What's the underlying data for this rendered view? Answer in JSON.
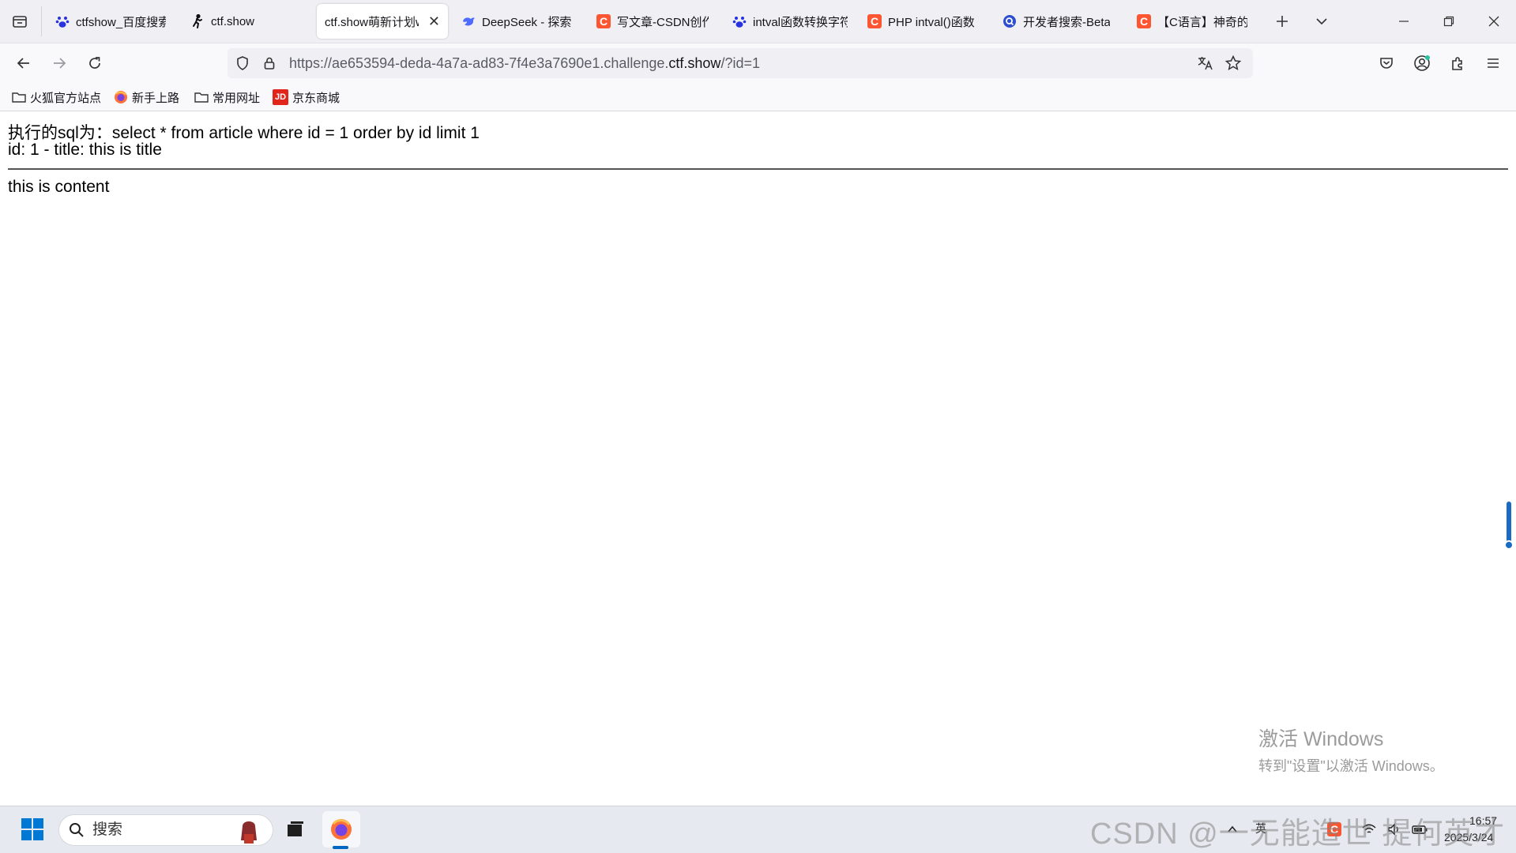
{
  "browser": {
    "tabs": [
      {
        "title": "ctfshow_百度搜索",
        "icon": "baidu-paw-icon",
        "active": false
      },
      {
        "title": "ctf.show",
        "icon": "ctfshow-runner-icon",
        "active": false
      },
      {
        "title": "ctf.show萌新计划web",
        "icon": "none",
        "active": true
      },
      {
        "title": "DeepSeek - 探索",
        "icon": "deepseek-whale-icon",
        "active": false
      },
      {
        "title": "写文章-CSDN创作",
        "icon": "csdn-icon",
        "active": false
      },
      {
        "title": "intval函数转换字符",
        "icon": "baidu-paw-icon",
        "active": false
      },
      {
        "title": "PHP intval()函数",
        "icon": "csdn-icon",
        "active": false
      },
      {
        "title": "开发者搜索-Beta",
        "icon": "dev-search-icon",
        "active": false
      },
      {
        "title": "【C语言】神奇的",
        "icon": "csdn-icon",
        "active": false
      }
    ],
    "url": {
      "prefix": "https://ae653594-deda-4a7a-ad83-7f4e3a7690e1.challenge.",
      "host": "ctf.show",
      "suffix": "/?id=1"
    },
    "bookmarks": [
      {
        "label": "火狐官方站点",
        "icon": "folder-icon"
      },
      {
        "label": "新手上路",
        "icon": "firefox-icon"
      },
      {
        "label": "常用网址",
        "icon": "folder-icon"
      },
      {
        "label": "京东商城",
        "icon": "jd-icon",
        "badge": "JD"
      }
    ],
    "csdn_glyph": "C"
  },
  "page": {
    "sql_line": "执行的sql为：select * from article where id = 1 order by id limit 1",
    "row_line": "id: 1 - title: this is title",
    "content_line": "this is content"
  },
  "overlay": {
    "activate_title": "激活 Windows",
    "activate_sub": "转到\"设置\"以激活 Windows。"
  },
  "taskbar": {
    "search_label": "搜索",
    "tray_ime": "英",
    "time": "16:57",
    "date": "2025/3/24",
    "watermark": "CSDN @一无能造世 提何英才"
  },
  "colors": {
    "accent": "#0067c0",
    "csdn": "#fc5531",
    "jd": "#e1251b"
  }
}
